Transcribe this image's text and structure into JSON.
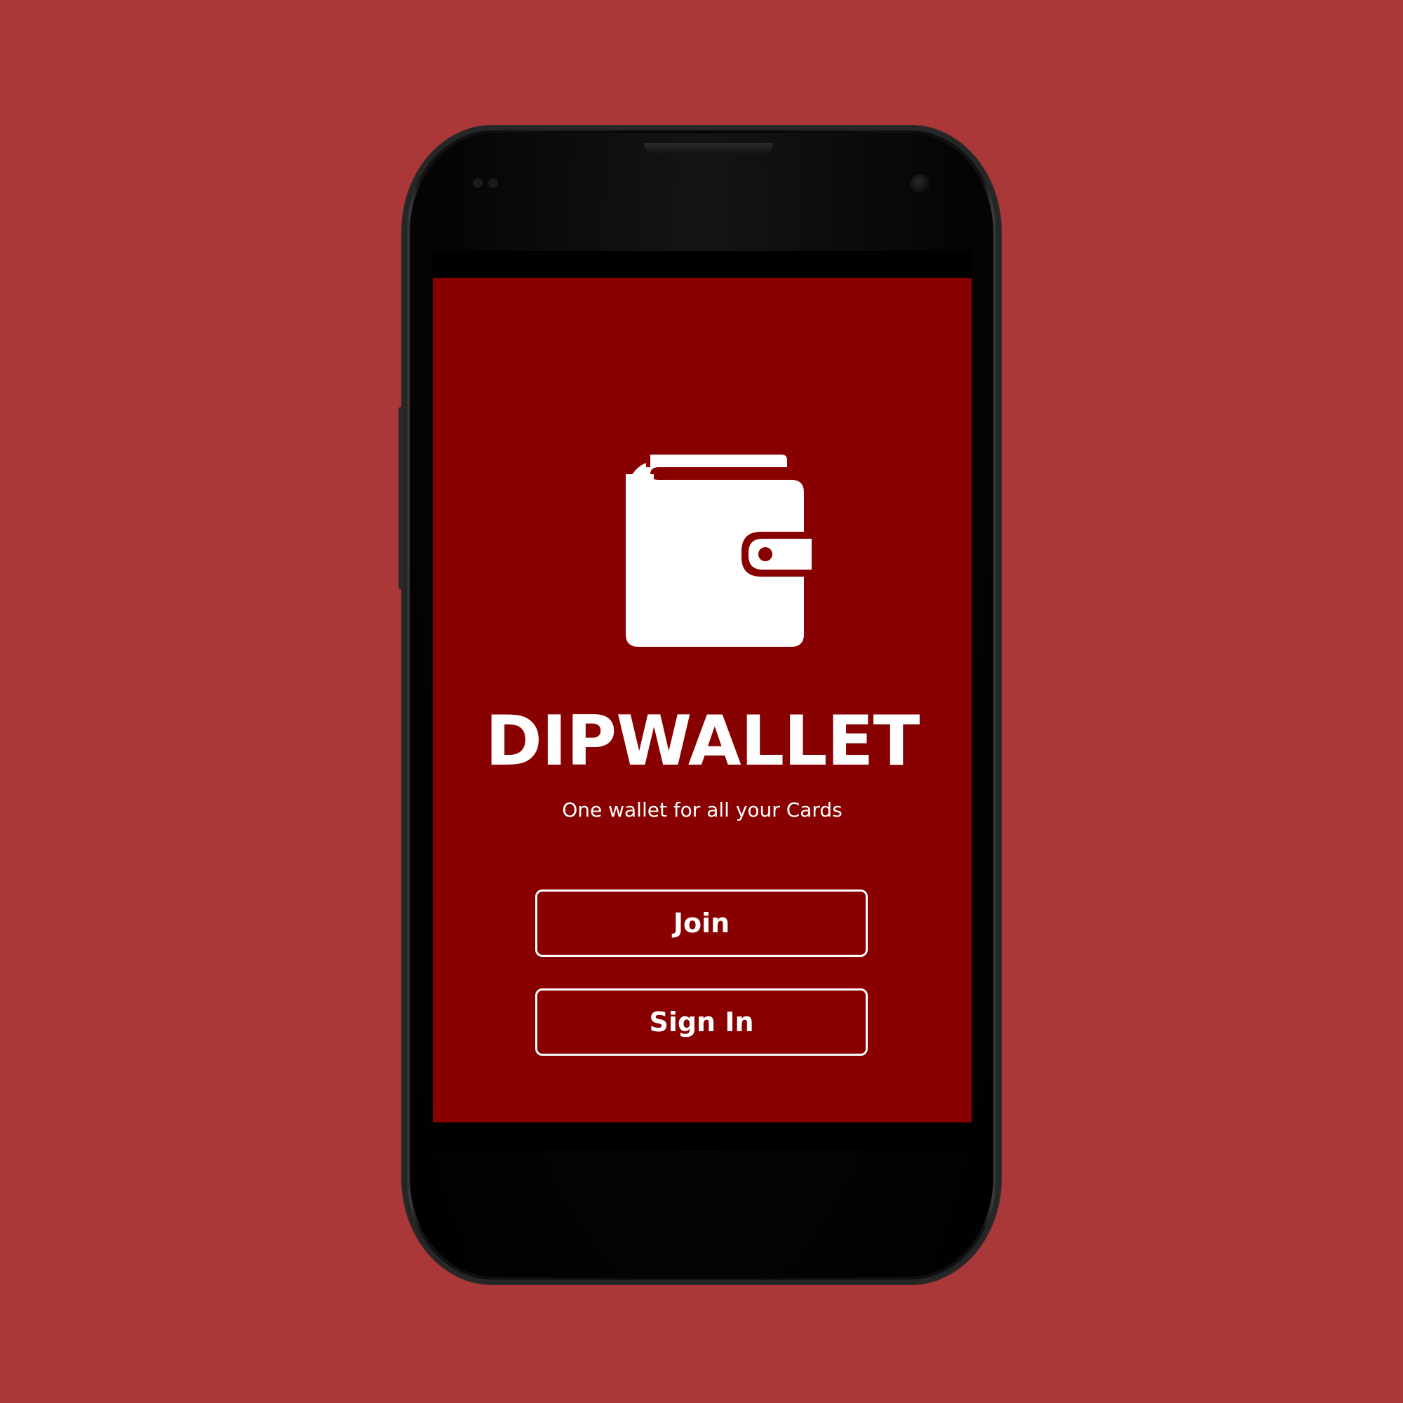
{
  "app": {
    "name": "DIPWALLET",
    "tagline": "One wallet for all your Cards",
    "logo_icon": "wallet-icon"
  },
  "actions": {
    "join_label": "Join",
    "signin_label": "Sign In"
  },
  "colors": {
    "page_background": "#ab3838",
    "app_background": "#880000",
    "foreground": "#ffffff",
    "device_body": "#0a0a0a"
  }
}
